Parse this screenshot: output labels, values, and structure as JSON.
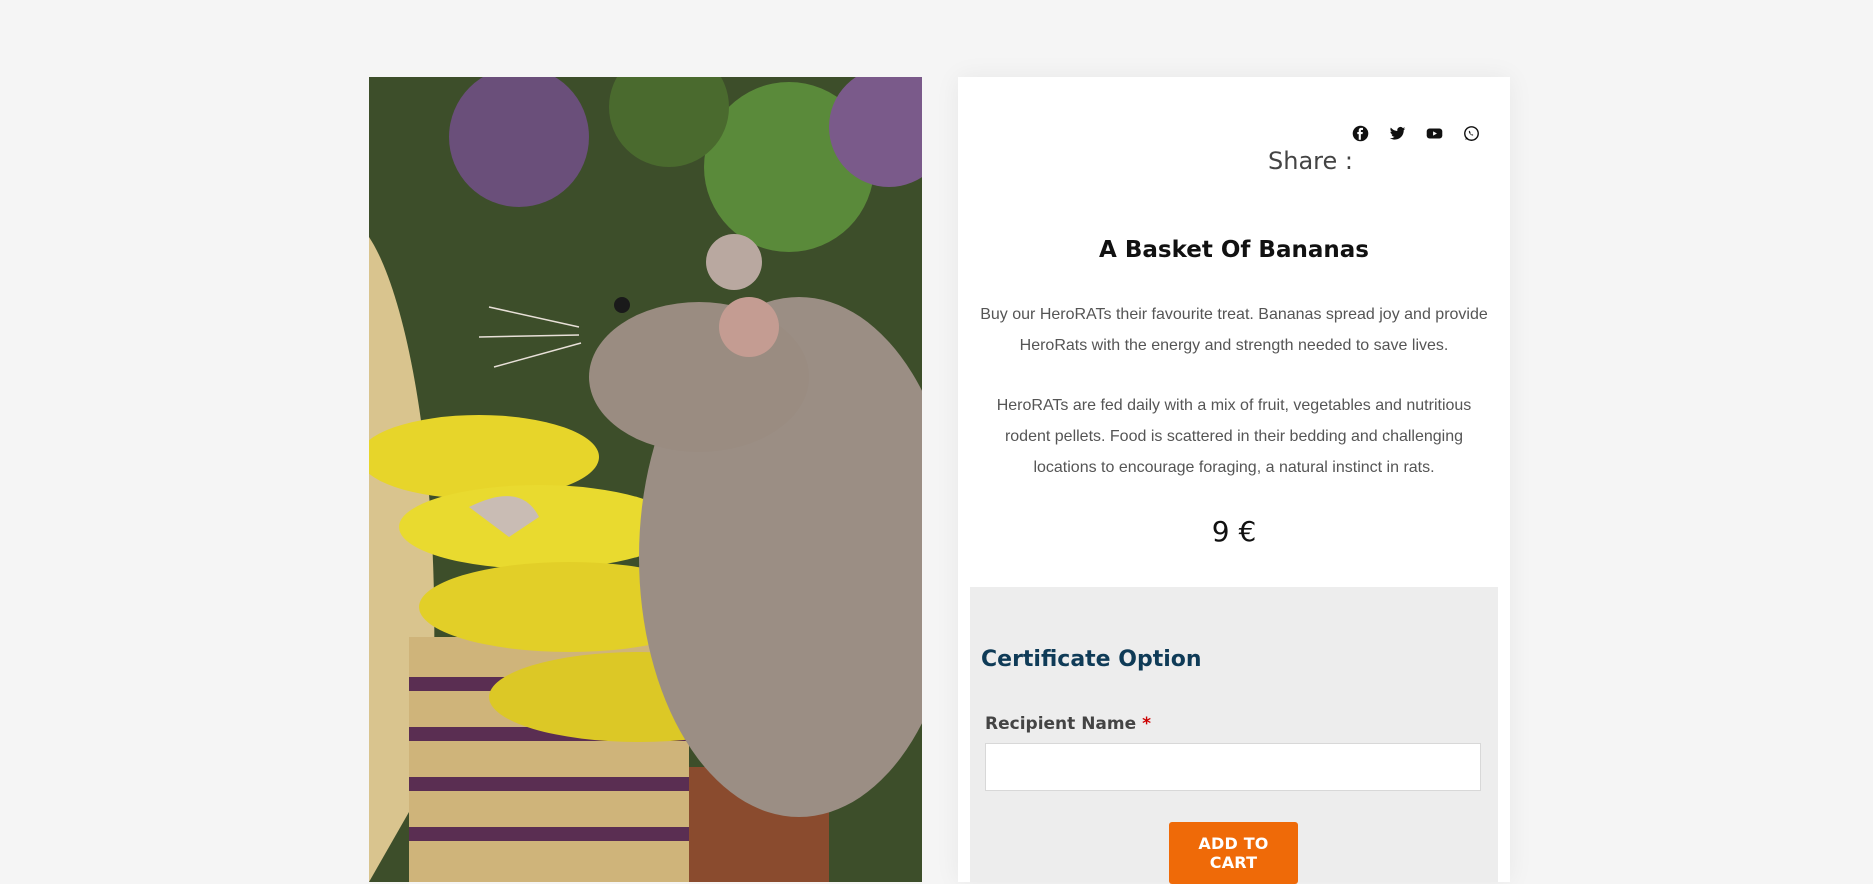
{
  "share": {
    "label": "Share :",
    "icons": [
      "facebook-icon",
      "twitter-icon",
      "youtube-icon",
      "whatsapp-icon"
    ]
  },
  "product": {
    "title": "A Basket Of Bananas",
    "description_1": "Buy our HeroRATs their favourite treat. Bananas spread joy and provide HeroRats with the energy and strength needed to save lives.",
    "description_2": "HeroRATs are fed daily with a mix of fruit, vegetables and nutritious rodent pellets. Food is scattered in their bedding and challenging locations to encourage foraging, a natural instinct in rats.",
    "price": "9 €"
  },
  "certificate": {
    "title": "Certificate Option",
    "recipient_label": "Recipient Name",
    "required_mark": "*",
    "recipient_value": ""
  },
  "cart": {
    "add_label": "ADD TO CART"
  },
  "colors": {
    "accent": "#ef6a08",
    "heading": "#0f3b57",
    "page_bg": "#f5f5f5"
  }
}
